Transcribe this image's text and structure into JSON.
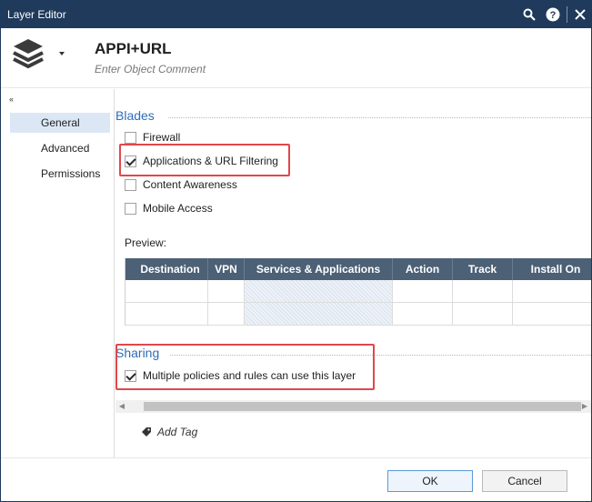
{
  "window": {
    "title": "Layer Editor"
  },
  "titlebar_icons": {
    "search": "search-icon",
    "help": "help-icon",
    "close": "close-icon"
  },
  "object": {
    "name": "APPI+URL",
    "comment_placeholder": "Enter Object Comment"
  },
  "sidebar": {
    "collapse_glyph": "‹‹",
    "items": [
      {
        "label": "General",
        "active": true
      },
      {
        "label": "Advanced",
        "active": false
      },
      {
        "label": "Permissions",
        "active": false
      }
    ]
  },
  "blades": {
    "title": "Blades",
    "items": [
      {
        "label": "Firewall",
        "checked": false
      },
      {
        "label": "Applications & URL Filtering",
        "checked": true
      },
      {
        "label": "Content Awareness",
        "checked": false
      },
      {
        "label": "Mobile Access",
        "checked": false
      }
    ]
  },
  "preview": {
    "label": "Preview:",
    "columns": [
      "Destination",
      "VPN",
      "Services & Applications",
      "Action",
      "Track",
      "Install On"
    ]
  },
  "sharing": {
    "title": "Sharing",
    "option_label": "Multiple policies and rules can use this layer",
    "checked": true
  },
  "add_tag": {
    "label": "Add Tag"
  },
  "footer": {
    "ok_label": "OK",
    "cancel_label": "Cancel"
  },
  "colors": {
    "titlebar": "#1f3a5b",
    "accent": "#2e6db5",
    "table_header": "#4c6076",
    "highlight": "#e0474c"
  }
}
